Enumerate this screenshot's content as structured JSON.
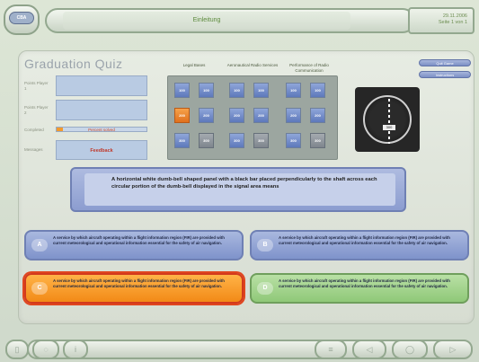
{
  "header": {
    "title": "Einleitung",
    "date": "29.11.2006",
    "page": "Seite 1 von 1"
  },
  "quiz": {
    "title": "Graduation Quiz",
    "labels": {
      "player1": "Points Player 1",
      "player2": "Points Player 2",
      "completed": "Completed",
      "messages": "Messages"
    },
    "progress_text": "Percent solved",
    "progress_fraction": 0.07,
    "feedback": "Feedback",
    "columns": [
      "Legal Bases",
      "Aeronautical Radio Services",
      "Performance of Radio Communication"
    ],
    "tiles": [
      [
        "100",
        "100",
        "100",
        "100",
        "100",
        "100"
      ],
      [
        "200",
        "200",
        "200",
        "200",
        "200",
        "200"
      ],
      [
        "300",
        "300",
        "300",
        "300",
        "300",
        "300"
      ]
    ],
    "buttons": {
      "quit": "Quit Game",
      "instructions": "Instructions"
    },
    "instrument_value": "300"
  },
  "question": "A horizontal white dumb-bell shaped panel with a black bar placed perpendicularly to the shaft across each circular portion of the dumb-bell displayed in the signal area means",
  "answers": [
    {
      "letter": "A",
      "text": "A service by which aircraft operating within a flight information region (FIR) are provided with current meteorological and operational information essential for the safety of air navigation."
    },
    {
      "letter": "B",
      "text": "A service by which aircraft operating within a flight information region (FIR) are provided with current meteorological and operational information essential for the safety of air navigation."
    },
    {
      "letter": "C",
      "text": "A service by which aircraft operating within a flight information region (FIR) are provided with current meteorological and operational information essential for the safety of air navigation."
    },
    {
      "letter": "D",
      "text": "A service by which aircraft operating within a flight information region (FIR) are provided with current meteorological and operational information essential for the safety of air navigation."
    }
  ],
  "footer": {
    "info": "i",
    "menu": "≡",
    "prev": "◁",
    "next": "▷"
  }
}
